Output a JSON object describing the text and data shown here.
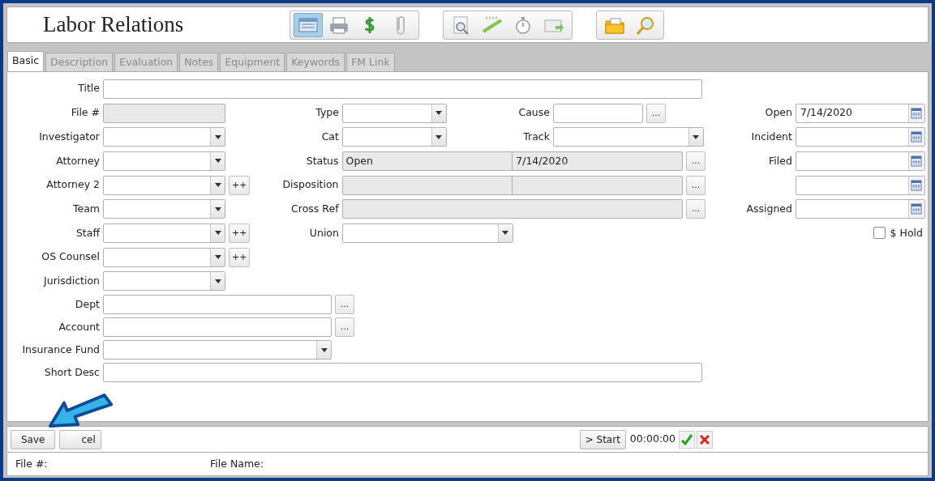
{
  "window": {
    "title": "Labor Relations"
  },
  "toolbar": [
    {
      "items": [
        {
          "kind": "form",
          "selected": true
        },
        {
          "kind": "print",
          "selected": false
        },
        {
          "kind": "money",
          "selected": false
        },
        {
          "kind": "clip",
          "selected": false
        }
      ]
    },
    {
      "items": [
        {
          "kind": "preview",
          "selected": false
        },
        {
          "kind": "ruler",
          "selected": false
        },
        {
          "kind": "timer",
          "selected": false
        },
        {
          "kind": "mail",
          "selected": false
        }
      ]
    },
    {
      "items": [
        {
          "kind": "folder",
          "selected": false
        },
        {
          "kind": "zoom",
          "selected": false
        }
      ]
    }
  ],
  "tabs": [
    {
      "label": "Basic",
      "selected": true
    },
    {
      "label": "Description",
      "selected": false
    },
    {
      "label": "Evaluation",
      "selected": false
    },
    {
      "label": "Notes",
      "selected": false
    },
    {
      "label": "Equipment",
      "selected": false
    },
    {
      "label": "Keywords",
      "selected": false
    },
    {
      "label": "FM Link",
      "selected": false
    }
  ],
  "form": {
    "title_field": {
      "label": "Title",
      "kind": "text"
    },
    "left_fields": [
      {
        "label": "File #",
        "kind": "readonly"
      },
      {
        "label": "Investigator",
        "kind": "combo"
      },
      {
        "label": "Attorney",
        "kind": "combo"
      },
      {
        "label": "Attorney 2",
        "kind": "combo",
        "add_button": "++"
      },
      {
        "label": "Team",
        "kind": "combo"
      },
      {
        "label": "Staff",
        "kind": "combo",
        "add_button": "++"
      },
      {
        "label": "OS Counsel",
        "kind": "combo",
        "add_button": "++"
      },
      {
        "label": "Jurisdiction",
        "kind": "combo"
      }
    ],
    "middle_fields": [
      {
        "label": "Type",
        "kind": "combo"
      },
      {
        "label": "Cat",
        "kind": "combo"
      },
      {
        "label": "Status",
        "kind": "split",
        "value": "Open",
        "value_2": "7/14/2020",
        "lookup_button": "..."
      },
      {
        "label": "Disposition",
        "kind": "split",
        "lookup_button": "..."
      },
      {
        "label": "Cross Ref",
        "kind": "readonly",
        "lookup_button": "..."
      },
      {
        "label": "Union",
        "kind": "combo_wide"
      }
    ],
    "cause_fields": [
      {
        "label": "Cause",
        "kind": "text",
        "lookup_button": "..."
      },
      {
        "label": "Track",
        "kind": "combo"
      }
    ],
    "date_fields": [
      {
        "label": "Open",
        "kind": "date",
        "value": "7/14/2020"
      },
      {
        "label": "Incident",
        "kind": "date"
      },
      {
        "label": "Filed",
        "kind": "date"
      },
      {
        "kind": "date"
      },
      {
        "label": "Assigned",
        "kind": "date"
      }
    ],
    "hold": {
      "label": "$ Hold",
      "checked": false
    },
    "bottom_fields": [
      {
        "label": "Dept",
        "kind": "text",
        "lookup_button": "..."
      },
      {
        "label": "Account",
        "kind": "text",
        "lookup_button": "..."
      },
      {
        "label": "Insurance Fund",
        "kind": "combo"
      },
      {
        "label": "Short Desc",
        "kind": "text_full"
      }
    ]
  },
  "footer": {
    "buttons": [
      {
        "label": "Save"
      },
      {
        "label": "cel"
      }
    ],
    "start_button": "> Start",
    "elapsed": "00:00:00"
  },
  "status_bar": [
    {
      "label": "File #:"
    },
    {
      "label": "File Name:"
    }
  ]
}
